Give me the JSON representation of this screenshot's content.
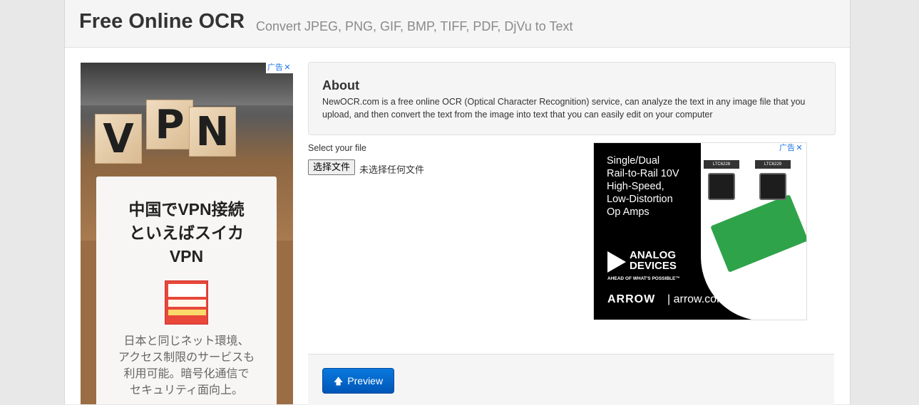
{
  "header": {
    "title": "Free Online OCR",
    "subtitle": "Convert JPEG, PNG, GIF, BMP, TIFF, PDF, DjVu to Text"
  },
  "ad_left": {
    "adchoice_label": "广告",
    "cubes": [
      "V",
      "P",
      "N"
    ],
    "headline_lines": [
      "中国でVPN接続",
      "といえばスイカ",
      "VPN"
    ],
    "body_lines": [
      "日本と同じネット環境、",
      "アクセス制限のサービスも",
      "利用可能。暗号化通信で",
      "セキュリティ面向上。"
    ]
  },
  "about": {
    "heading": "About",
    "text": "NewOCR.com is a free online OCR (Optical Character Recognition) service, can analyze the text in any image file that you upload, and then convert the text from the image into text that you can easily edit on your computer"
  },
  "upload": {
    "select_label": "Select your file",
    "button_label": "选择文件",
    "status": "未选择任何文件"
  },
  "ad_right": {
    "adchoice_label": "广告",
    "headline_lines": [
      "Single/Dual",
      "Rail-to-Rail 10V",
      "High-Speed,",
      "Low-Distortion",
      "Op Amps"
    ],
    "chip_labels": [
      "LTC6228",
      "LTC6229"
    ],
    "logo_lines": [
      "ANALOG",
      "DEVICES"
    ],
    "tagline": "AHEAD OF WHAT'S POSSIBLE™",
    "brand": "ARROW",
    "url": "| arrow.com"
  },
  "actions": {
    "preview_label": "Preview",
    "preview_icon": "arrow-up-icon"
  },
  "colors": {
    "primary_button": "#0a6fd0",
    "header_bg": "#f5f5f5",
    "adchoice": "#1a73e8"
  }
}
